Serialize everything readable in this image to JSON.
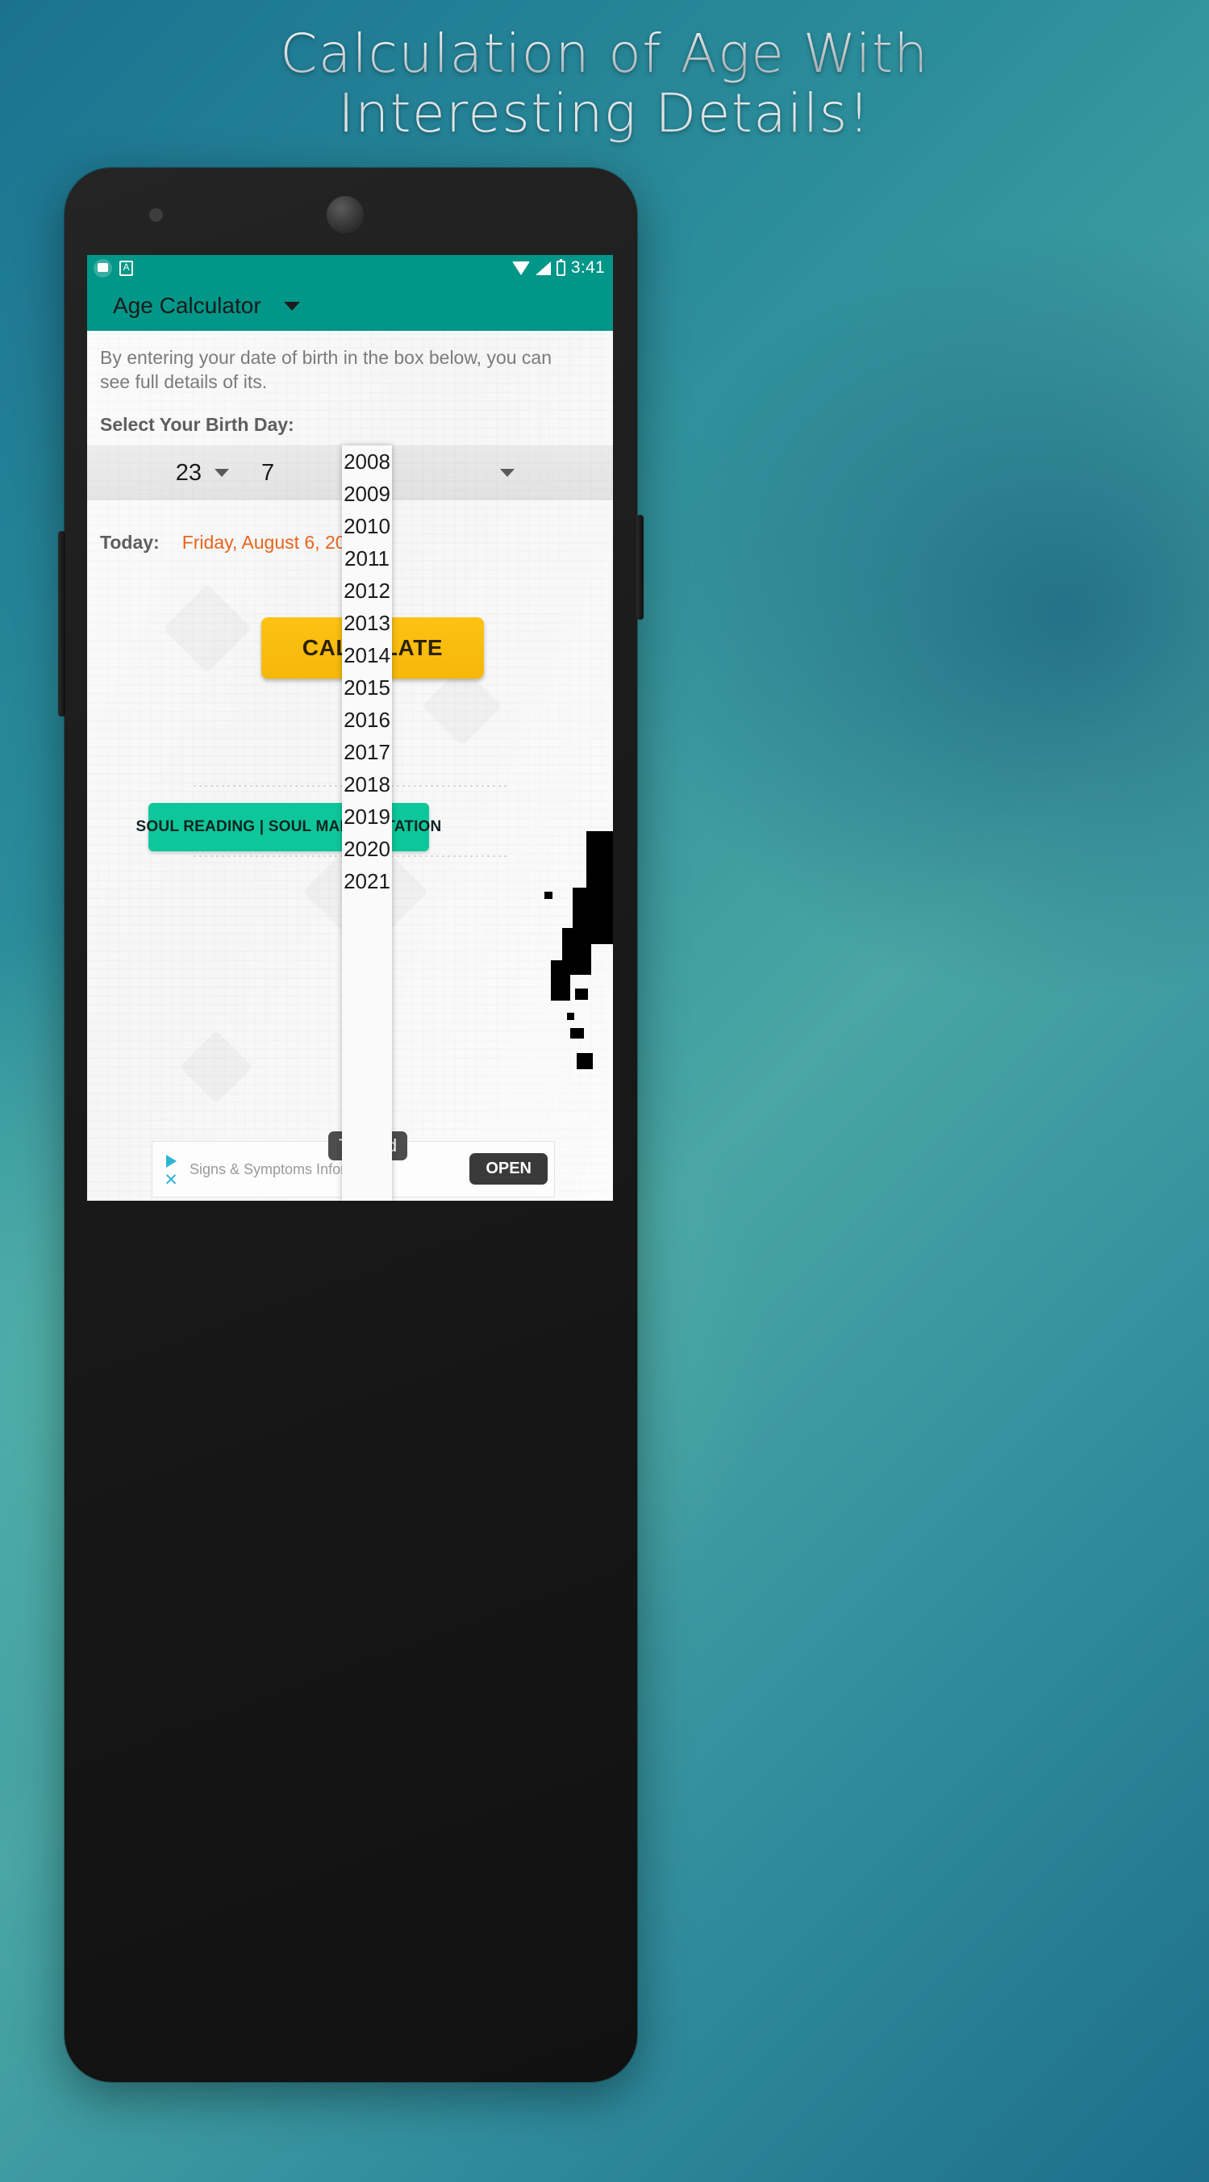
{
  "promo": {
    "title_line_1": "Calculation of Age With",
    "title_line_2": "Interesting Details!"
  },
  "status_bar": {
    "time": "3:41",
    "icons": [
      "app-notification-icon",
      "screenshot-icon",
      "wifi-icon",
      "signal-icon",
      "battery-icon"
    ]
  },
  "toolbar": {
    "title": "Age Calculator"
  },
  "content": {
    "intro_text": "By entering your date of birth in the box below, you can see full details of its.",
    "birth_day_label": "Select Your Birth Day:",
    "today_label": "Today:",
    "today_value": "Friday, August 6, 2021",
    "calculate_label": "CALCULATE"
  },
  "date_spinners": {
    "day": "23",
    "month": "7",
    "year": "2008"
  },
  "year_dropdown": {
    "open": true,
    "selected": "2008",
    "options": [
      "2008",
      "2009",
      "2010",
      "2011",
      "2012",
      "2013",
      "2014",
      "2015",
      "2016",
      "2017",
      "2018",
      "2019",
      "2020",
      "2021"
    ]
  },
  "soul_ad": {
    "label": "SOUL READING | SOUL MANIFESTATION"
  },
  "bottom_ad": {
    "headline": "Signs & Symptoms Information",
    "badge": "Test Ad",
    "open_label": "OPEN",
    "close_label": "✕"
  },
  "colors": {
    "teal_primary": "#009688",
    "accent_yellow": "#fdc213",
    "accent_orange": "#e8641c",
    "ad_green": "#0dc79b",
    "backdrop_teal": "#2b8c9a"
  }
}
